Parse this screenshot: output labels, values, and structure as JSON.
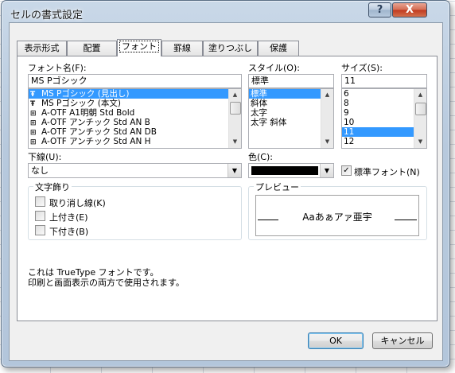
{
  "window": {
    "title": "セルの書式設定"
  },
  "caption": {
    "help": "?",
    "close": "X"
  },
  "tabs": [
    {
      "label": "表示形式"
    },
    {
      "label": "配置"
    },
    {
      "label": "フォント"
    },
    {
      "label": "罫線"
    },
    {
      "label": "塗りつぶし"
    },
    {
      "label": "保護"
    }
  ],
  "font_name": {
    "label": "フォント名(F):",
    "value": "MS Pゴシック",
    "items": [
      {
        "icon": "truetype-icon",
        "text": "MS Pゴシック (見出し)",
        "selected": true
      },
      {
        "icon": "truetype-icon",
        "text": "MS Pゴシック (本文)",
        "selected": false
      },
      {
        "icon": "opentype-icon",
        "text": "A-OTF A1明朝 Std Bold",
        "selected": false
      },
      {
        "icon": "opentype-icon",
        "text": "A-OTF アンチック Std AN B",
        "selected": false
      },
      {
        "icon": "opentype-icon",
        "text": "A-OTF アンチック Std AN DB",
        "selected": false
      },
      {
        "icon": "opentype-icon",
        "text": "A-OTF アンチック Std AN H",
        "selected": false
      }
    ]
  },
  "style": {
    "label": "スタイル(O):",
    "value": "標準",
    "items": [
      {
        "text": "標準",
        "selected": true
      },
      {
        "text": "斜体",
        "selected": false
      },
      {
        "text": "太字",
        "selected": false
      },
      {
        "text": "太字 斜体",
        "selected": false
      }
    ]
  },
  "size": {
    "label": "サイズ(S):",
    "value": "11",
    "items": [
      {
        "text": "6",
        "selected": false
      },
      {
        "text": "8",
        "selected": false
      },
      {
        "text": "9",
        "selected": false
      },
      {
        "text": "10",
        "selected": false
      },
      {
        "text": "11",
        "selected": true
      },
      {
        "text": "12",
        "selected": false
      }
    ]
  },
  "underline": {
    "label": "下線(U):",
    "value": "なし"
  },
  "color": {
    "label": "色(C):",
    "swatch": "#000000",
    "normal_font_label": "標準フォント(N)",
    "normal_font_checked": true
  },
  "effects": {
    "title": "文字飾り",
    "strikethrough": "取り消し線(K)",
    "superscript": "上付き(E)",
    "subscript": "下付き(B)"
  },
  "preview": {
    "title": "プレビュー",
    "sample": "Aaあぁアァ亜宇"
  },
  "info": {
    "line1": "これは TrueType フォントです。",
    "line2": "印刷と画面表示の両方で使用されます。"
  },
  "buttons": {
    "ok": "OK",
    "cancel": "キャンセル"
  }
}
